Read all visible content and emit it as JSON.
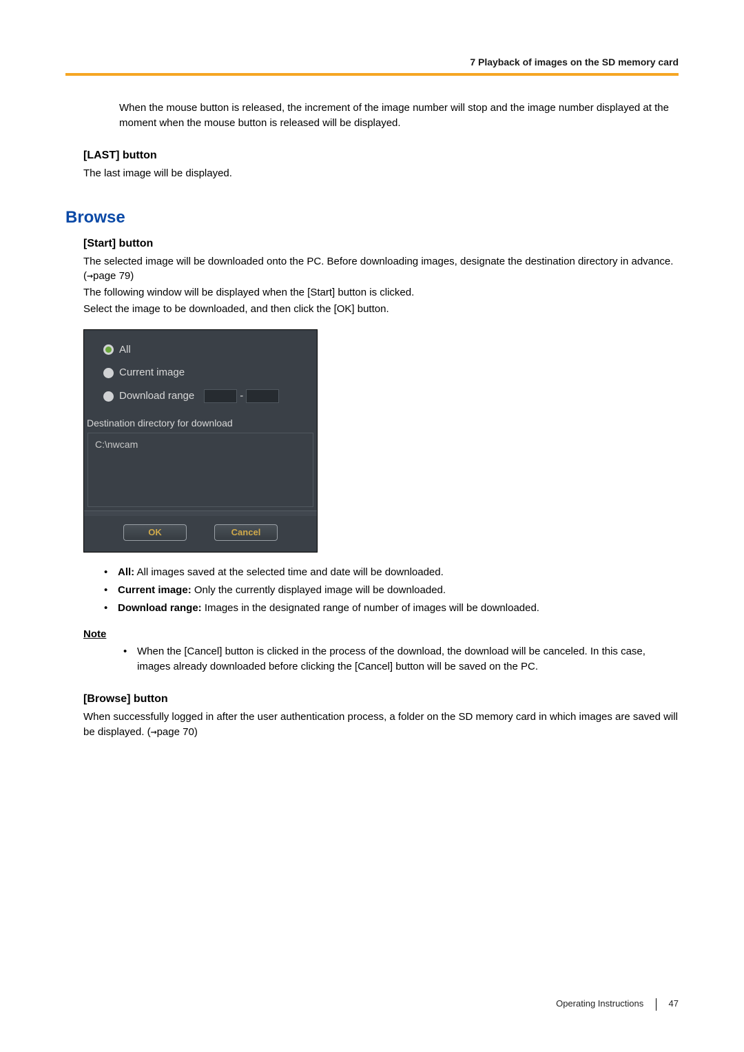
{
  "header": {
    "section_title": "7  Playback of images on the SD memory card"
  },
  "body": {
    "intro_para": "When the mouse button is released, the increment of the image number will stop and the image number displayed at the moment when the mouse button is released will be displayed.",
    "last": {
      "heading": "[LAST] button",
      "text": "The last image will be displayed."
    },
    "browse_heading": "Browse",
    "start": {
      "heading": "[Start] button",
      "p1a": "The selected image will be downloaded onto the PC. Before downloading images, designate the destination directory in advance. (",
      "p1b": "page 79)",
      "p2": "The following window will be displayed when the [Start] button is clicked.",
      "p3": "Select the image to be downloaded, and then click the [OK] button."
    },
    "dialog": {
      "opt_all": "All",
      "opt_current": "Current image",
      "opt_range": "Download range",
      "dest_label": "Destination directory for download",
      "dest_path": "C:\\nwcam",
      "ok": "OK",
      "cancel": "Cancel"
    },
    "options": {
      "all_label": "All:",
      "all_text": " All images saved at the selected time and date will be downloaded.",
      "current_label": "Current image:",
      "current_text": " Only the currently displayed image will be downloaded.",
      "range_label": "Download range:",
      "range_text": " Images in the designated range of number of images will be downloaded."
    },
    "note": {
      "heading": "Note",
      "item": "When the [Cancel] button is clicked in the process of the download, the download will be canceled. In this case, images already downloaded before clicking the [Cancel] button will be saved on the PC."
    },
    "browse_btn": {
      "heading": "[Browse] button",
      "text_a": "When successfully logged in after the user authentication process, a folder on the SD memory card in which images are saved will be displayed. (",
      "text_b": "page 70)"
    }
  },
  "footer": {
    "label": "Operating Instructions",
    "page": "47"
  }
}
